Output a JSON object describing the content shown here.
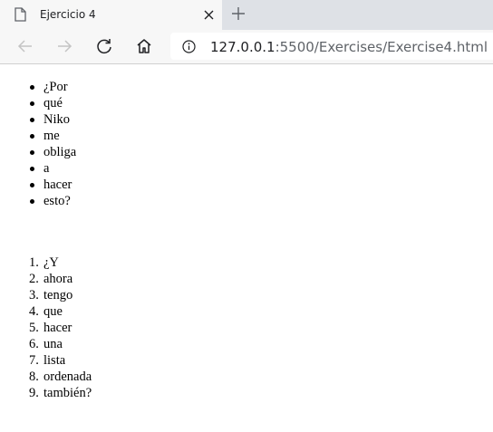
{
  "browser": {
    "tab": {
      "title": "Ejercicio 4"
    },
    "address": {
      "host": "127.0.0.1",
      "rest": ":5500/Exercises/Exercise4.html"
    }
  },
  "page": {
    "unordered_list": [
      "¿Por",
      "qué",
      "Niko",
      "me",
      "obliga",
      "a",
      "hacer",
      "esto?"
    ],
    "ordered_list": [
      "¿Y",
      "ahora",
      "tengo",
      "que",
      "hacer",
      "una",
      "lista",
      "ordenada",
      "también?"
    ]
  }
}
